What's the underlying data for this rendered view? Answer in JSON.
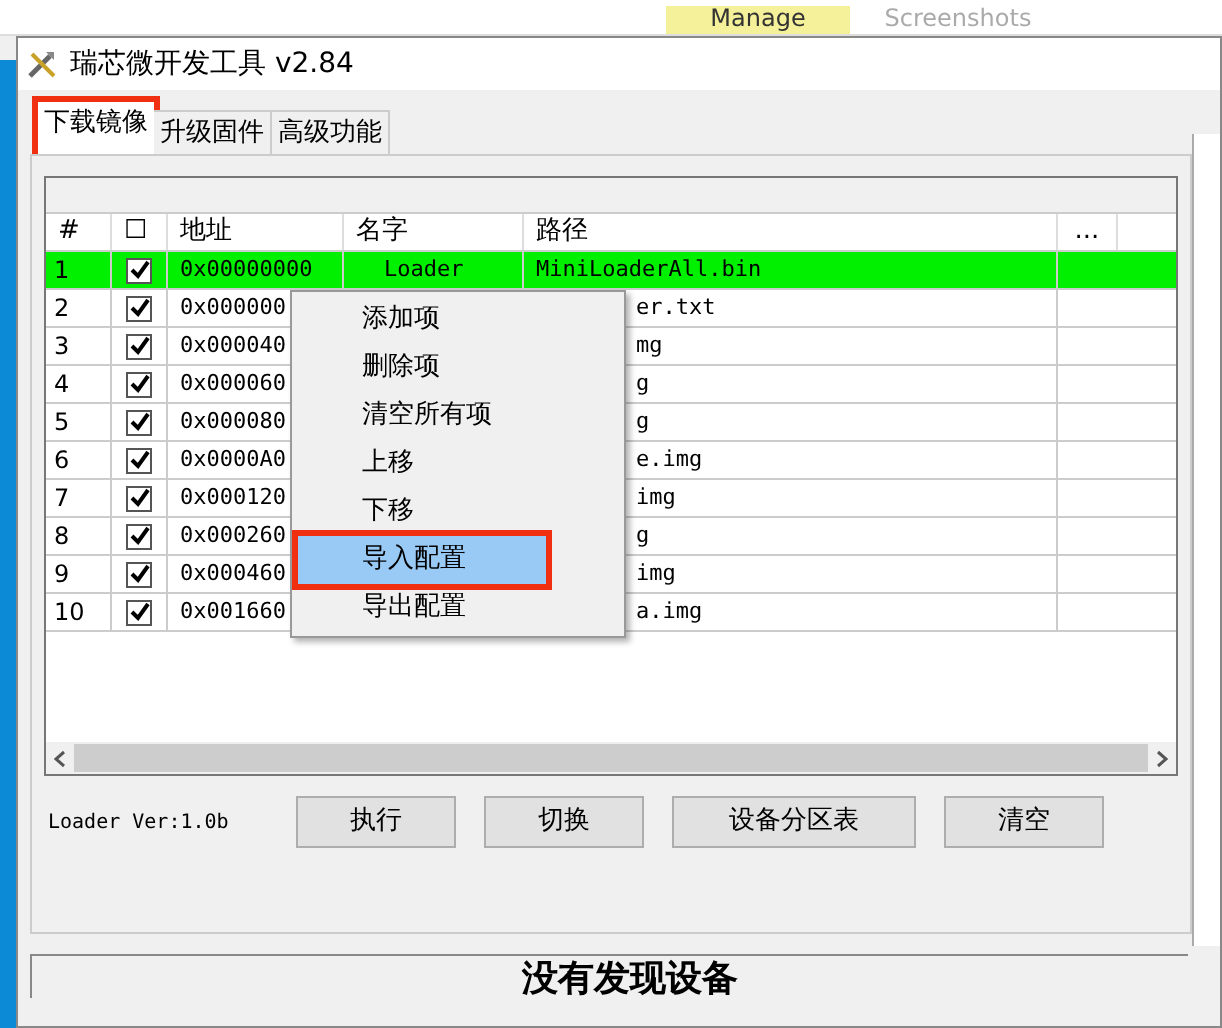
{
  "explorer_ribbon": {
    "tabs": [
      {
        "label": "Manage",
        "selected": true
      },
      {
        "label": "Screenshots",
        "selected": false
      }
    ]
  },
  "window": {
    "title": "瑞芯微开发工具 v2.84"
  },
  "tabs": [
    {
      "label": "下载镜像",
      "selected": true,
      "annotated": true
    },
    {
      "label": "升级固件",
      "selected": false,
      "annotated": false
    },
    {
      "label": "高级功能",
      "selected": false,
      "annotated": false
    }
  ],
  "table": {
    "columns": [
      "#",
      "☐",
      "地址",
      "名字",
      "路径",
      "..."
    ],
    "rows": [
      {
        "index": "1",
        "checked": true,
        "selected": true,
        "address": "0x00000000",
        "name": "Loader",
        "path": "MiniLoaderAll.bin"
      },
      {
        "index": "2",
        "checked": true,
        "selected": false,
        "address": "0x000000",
        "path": "er.txt"
      },
      {
        "index": "3",
        "checked": true,
        "selected": false,
        "address": "0x000040",
        "path": "mg"
      },
      {
        "index": "4",
        "checked": true,
        "selected": false,
        "address": "0x000060",
        "path": "g"
      },
      {
        "index": "5",
        "checked": true,
        "selected": false,
        "address": "0x000080",
        "path": "g"
      },
      {
        "index": "6",
        "checked": true,
        "selected": false,
        "address": "0x0000A0",
        "path": "e.img"
      },
      {
        "index": "7",
        "checked": true,
        "selected": false,
        "address": "0x000120",
        "path": "img"
      },
      {
        "index": "8",
        "checked": true,
        "selected": false,
        "address": "0x000260",
        "path": "g"
      },
      {
        "index": "9",
        "checked": true,
        "selected": false,
        "address": "0x000460",
        "path": "img"
      },
      {
        "index": "10",
        "checked": true,
        "selected": false,
        "address": "0x001660",
        "path": "a.img"
      }
    ]
  },
  "context_menu": [
    {
      "label": "添加项",
      "selected": false,
      "annotated": false
    },
    {
      "label": "删除项",
      "selected": false,
      "annotated": false
    },
    {
      "label": "清空所有项",
      "selected": false,
      "annotated": false
    },
    {
      "label": "上移",
      "selected": false,
      "annotated": false
    },
    {
      "label": "下移",
      "selected": false,
      "annotated": false
    },
    {
      "label": "导入配置",
      "selected": true,
      "annotated": true
    },
    {
      "label": "导出配置",
      "selected": false,
      "annotated": false
    }
  ],
  "loader_version": "Loader Ver:1.0b",
  "buttons": [
    "执行",
    "切换",
    "设备分区表",
    "清空"
  ],
  "status": "没有发现设备"
}
